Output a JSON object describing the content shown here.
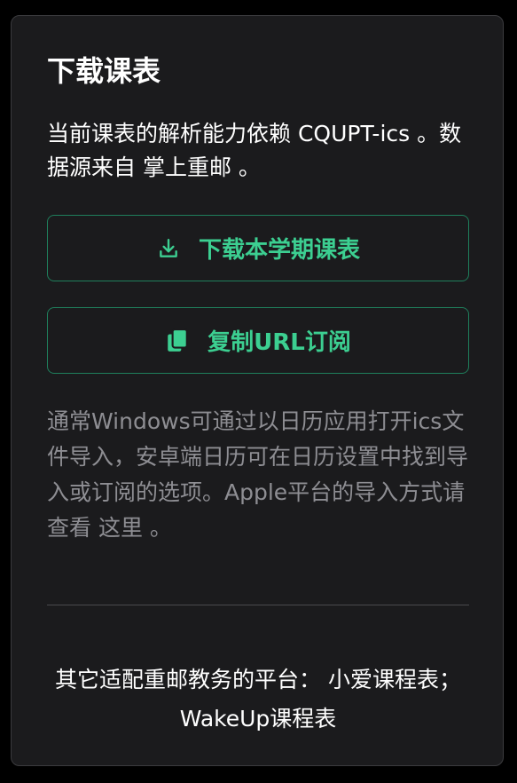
{
  "card": {
    "title": "下载课表",
    "description": {
      "prefix": "当前课表的解析能力依赖 ",
      "link1": "CQUPT-ics",
      "middle": " 。数据源来自 ",
      "link2": "掌上重邮",
      "suffix": " 。"
    },
    "download_button": {
      "label": "下载本学期课表",
      "icon": "download-icon"
    },
    "copy_button": {
      "label": "复制URL订阅",
      "icon": "copy-icon"
    },
    "hint": {
      "text": "通常Windows可通过以日历应用打开ics文件导入，安卓端日历可在日历设置中找到导入或订阅的选项。Apple平台的导入方式请查看 ",
      "link": "这里",
      "suffix": " 。"
    },
    "other": {
      "prefix": "其它适配重邮教务的平台： ",
      "link1": "小爱课程表",
      "separator": "； ",
      "link2": "WakeUp课程表"
    }
  },
  "colors": {
    "background": "#000000",
    "card": "#1b1b1d",
    "accent": "#3ccf91",
    "accent_border": "#1f7f5c",
    "muted_text": "#8e8e93"
  }
}
